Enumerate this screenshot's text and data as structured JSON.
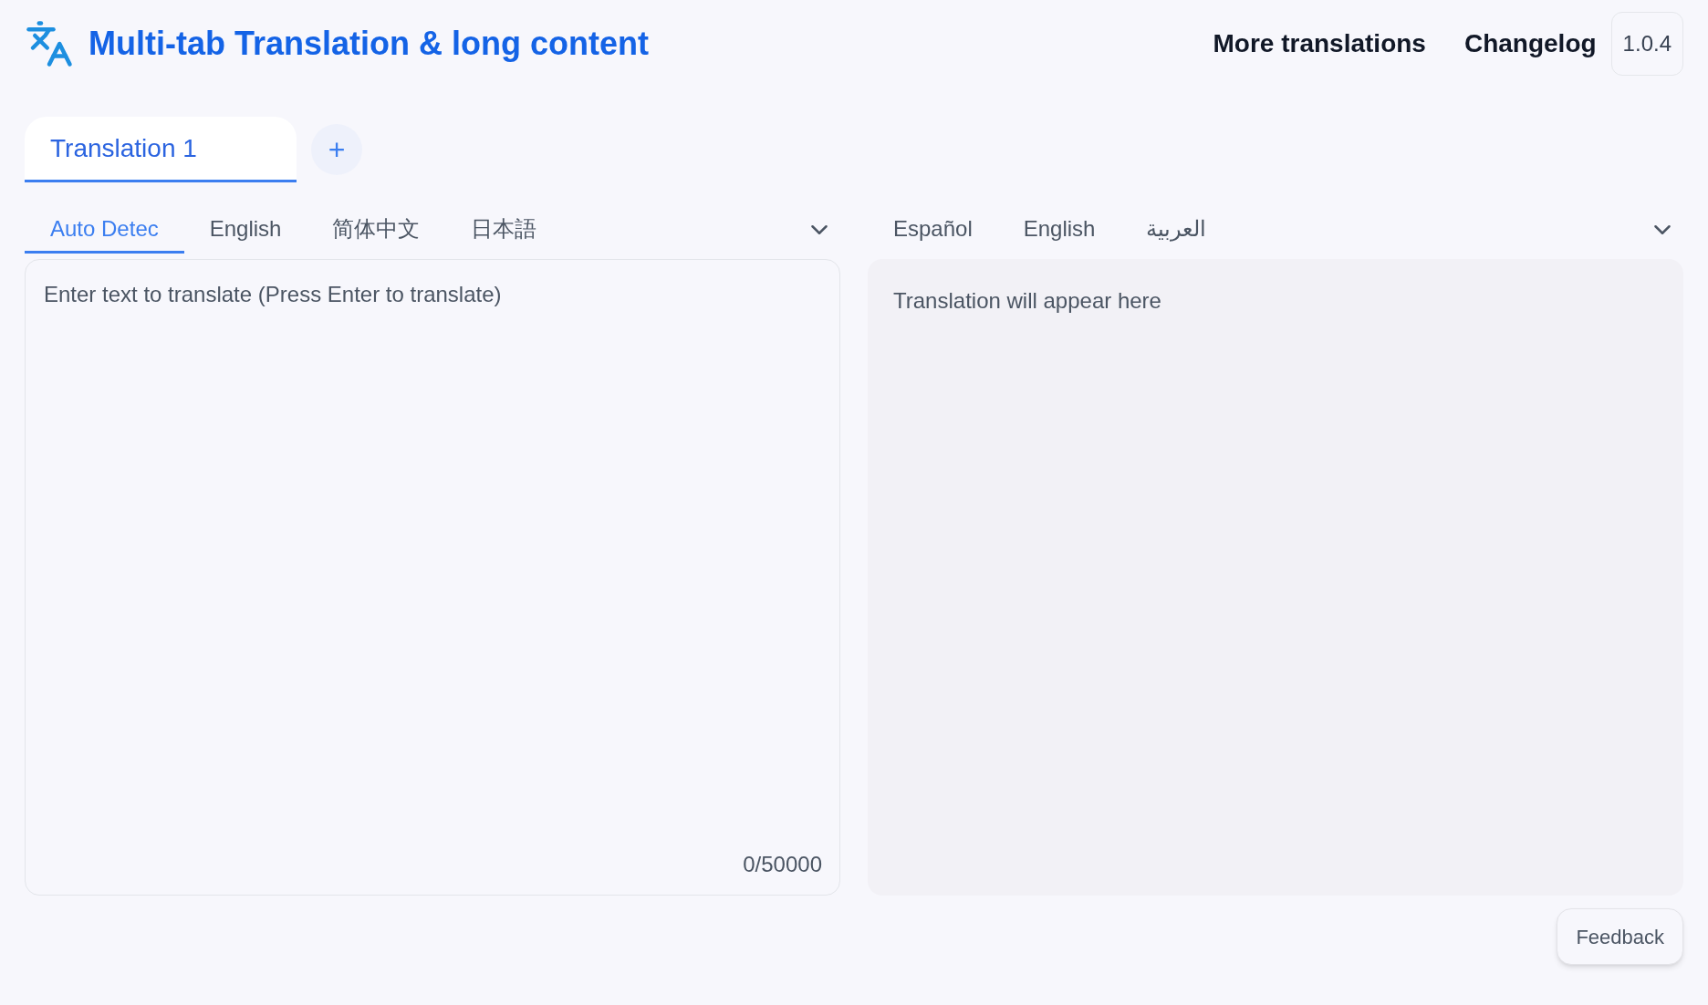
{
  "header": {
    "title": "Multi-tab Translation & long content",
    "links": [
      "More translations",
      "Changelog"
    ],
    "version": "1.0.4"
  },
  "tabs": [
    {
      "label": "Translation 1",
      "selected": true
    }
  ],
  "add_tab": "+",
  "source_languages": [
    {
      "label": "Auto Detec",
      "selected": true
    },
    {
      "label": "English",
      "selected": false
    },
    {
      "label": "简体中文",
      "selected": false
    },
    {
      "label": "日本語",
      "selected": false
    }
  ],
  "target_languages": [
    {
      "label": "Español",
      "selected": false
    },
    {
      "label": "English",
      "selected": false
    },
    {
      "label": "العربية",
      "selected": false
    }
  ],
  "source": {
    "placeholder": "Enter text to translate (Press Enter to translate)",
    "count": "0/50000"
  },
  "output": {
    "placeholder": "Translation will appear here"
  },
  "feedback": "Feedback"
}
